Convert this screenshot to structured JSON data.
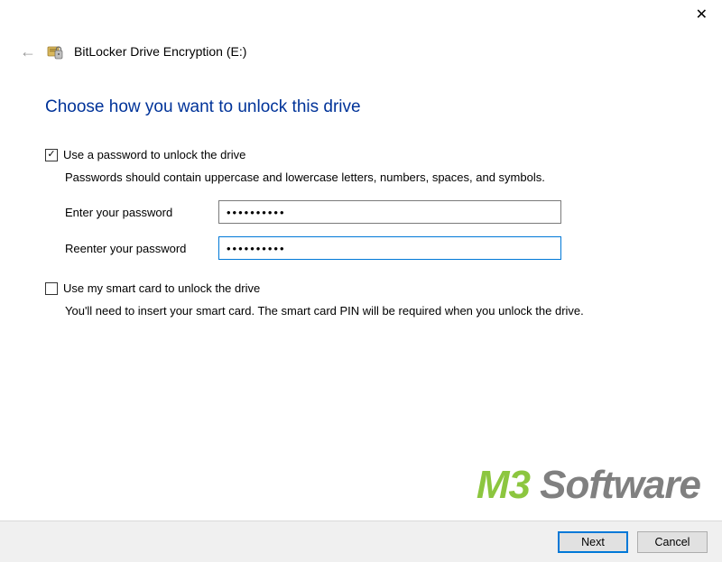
{
  "window": {
    "title": "BitLocker Drive Encryption (E:)"
  },
  "page": {
    "heading": "Choose how you want to unlock this drive"
  },
  "options": {
    "password": {
      "checked": true,
      "label": "Use a password to unlock the drive",
      "hint": "Passwords should contain uppercase and lowercase letters, numbers, spaces, and symbols.",
      "enter_label": "Enter your password",
      "reenter_label": "Reenter your password",
      "enter_value": "••••••••••",
      "reenter_value": "••••••••••"
    },
    "smartcard": {
      "checked": false,
      "label": "Use my smart card to unlock the drive",
      "hint": "You'll need to insert your smart card. The smart card PIN will be required when you unlock the drive."
    }
  },
  "footer": {
    "next": "Next",
    "cancel": "Cancel"
  },
  "watermark": {
    "part1": "M3",
    "part2": " Software"
  }
}
